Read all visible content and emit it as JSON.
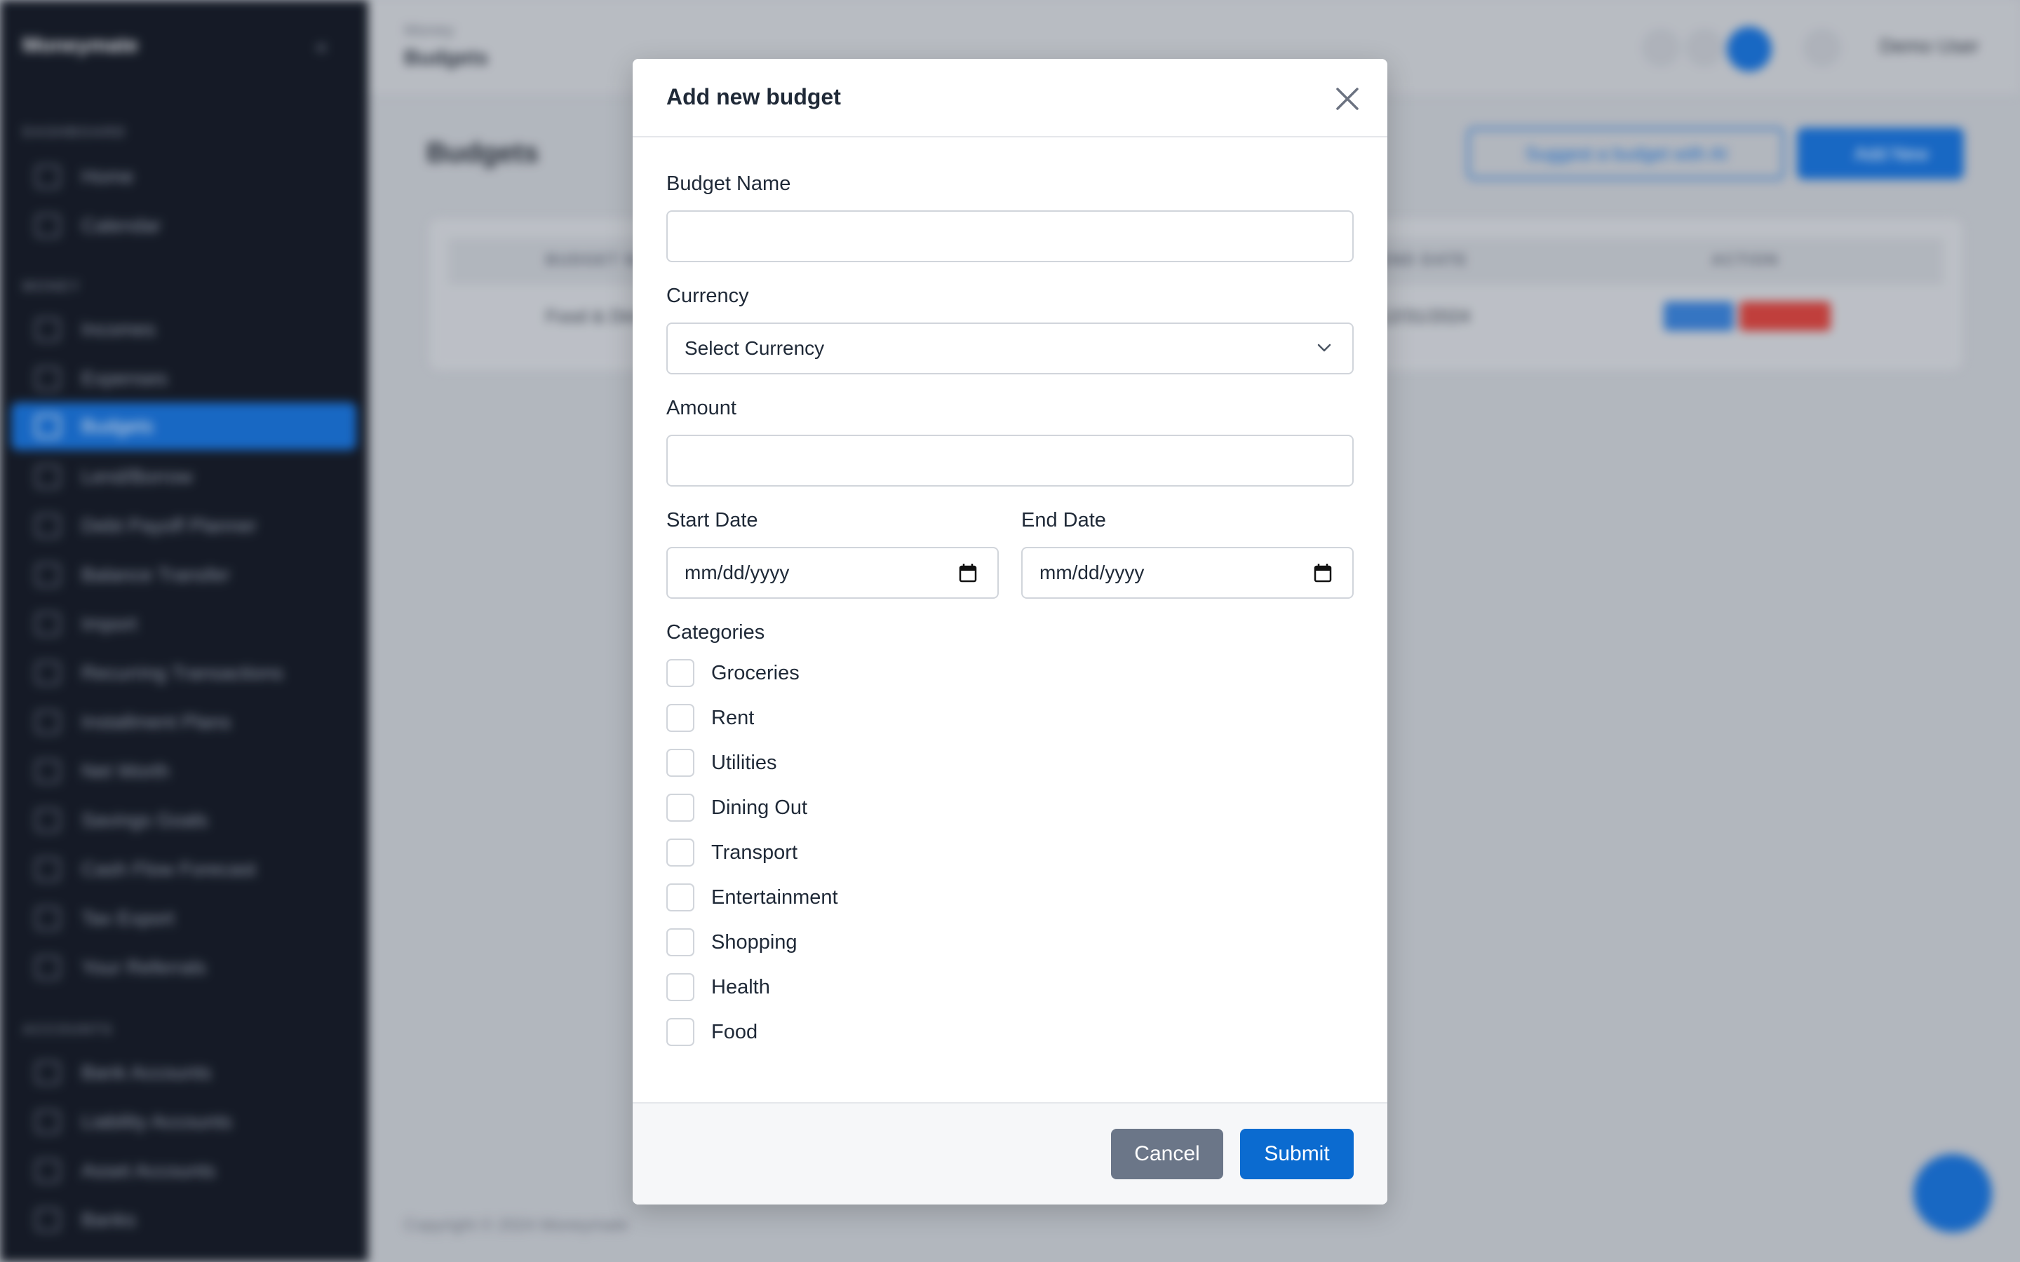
{
  "app": {
    "name": "Moneymate",
    "user": "Demo User",
    "copyright": "Copyright © 2024 Moneymate"
  },
  "sidebar": {
    "sections": [
      "DASHBOARD",
      "MONEY",
      "ACCOUNTS"
    ],
    "items": [
      {
        "label": "Home"
      },
      {
        "label": "Calendar"
      },
      {
        "label": "Incomes"
      },
      {
        "label": "Expenses"
      },
      {
        "label": "Budgets"
      },
      {
        "label": "Lend/Borrow"
      },
      {
        "label": "Debt Payoff Planner"
      },
      {
        "label": "Balance Transfer"
      },
      {
        "label": "Import"
      },
      {
        "label": "Recurring Transactions"
      },
      {
        "label": "Installment Plans"
      },
      {
        "label": "Net Worth"
      },
      {
        "label": "Savings Goals"
      },
      {
        "label": "Cash Flow Forecast"
      },
      {
        "label": "Tax Export"
      },
      {
        "label": "Your Referrals"
      },
      {
        "label": "Bank Accounts"
      },
      {
        "label": "Liability Accounts"
      },
      {
        "label": "Asset Accounts"
      },
      {
        "label": "Banks"
      }
    ]
  },
  "header": {
    "breadcrumb_parent": "Money",
    "breadcrumb_current": "Budgets"
  },
  "page": {
    "title": "Budgets",
    "ai_button": "Suggest a budget with AI",
    "add_button": "Add New",
    "table": {
      "headers": [
        "BUDGET NAME",
        "END DATE",
        "ACTION"
      ],
      "row": {
        "name": "Food & Dining",
        "end_date": "12/31/2024",
        "edit": "Edit",
        "delete": "Delete"
      }
    }
  },
  "modal": {
    "title": "Add new budget",
    "budget_name": {
      "label": "Budget Name",
      "value": ""
    },
    "currency": {
      "label": "Currency",
      "value": "Select Currency"
    },
    "amount": {
      "label": "Amount",
      "value": ""
    },
    "start_date": {
      "label": "Start Date",
      "value": "mm/dd/yyyy"
    },
    "end_date": {
      "label": "End Date",
      "value": "mm/dd/yyyy"
    },
    "categories_label": "Categories",
    "categories": [
      "Groceries",
      "Rent",
      "Utilities",
      "Dining Out",
      "Transport",
      "Entertainment",
      "Shopping",
      "Health",
      "Food"
    ],
    "cancel": "Cancel",
    "submit": "Submit"
  },
  "icons": [
    "close-icon",
    "chevron-down-icon",
    "calendar-icon"
  ],
  "colors": {
    "primary": "#0b6bd0",
    "cancel": "#6b7688",
    "sidebar_bg": "#161b26"
  }
}
